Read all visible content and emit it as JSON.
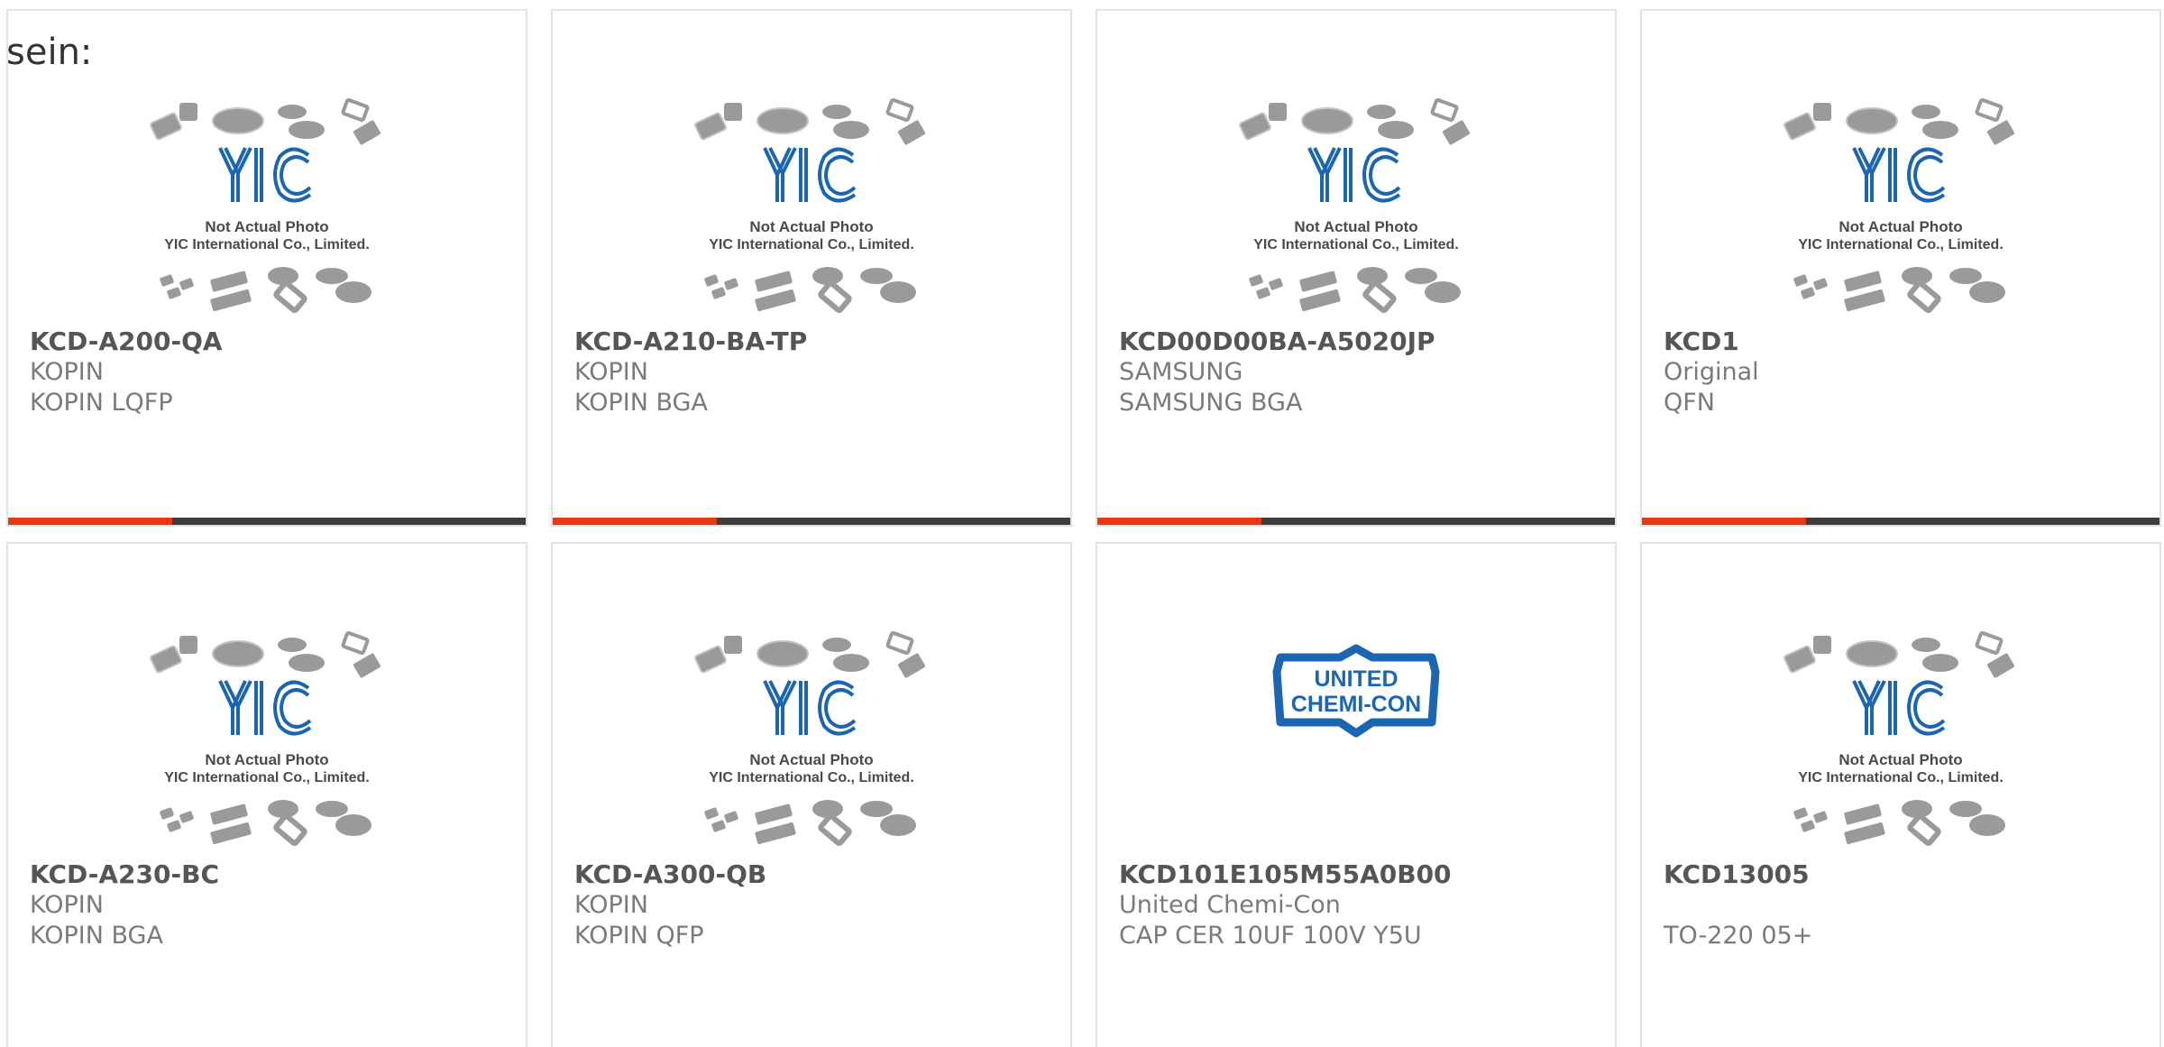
{
  "intro_text": "sein:",
  "image_caption": {
    "line1": "Not Actual Photo",
    "line2": "YIC International Co., Limited.",
    "logo_text": "YIC"
  },
  "brand_logo": {
    "line1": "UNITED",
    "line2": "CHEMI-CON"
  },
  "colors": {
    "accent": "#e8380d",
    "bar": "#3d3d3d",
    "logo_blue": "#1a66b3"
  },
  "products": [
    {
      "part": "KCD-A200-QA",
      "manufacturer": "KOPIN",
      "description": "KOPIN LQFP",
      "image": "yic-placeholder"
    },
    {
      "part": "KCD-A210-BA-TP",
      "manufacturer": "KOPIN",
      "description": "KOPIN BGA",
      "image": "yic-placeholder"
    },
    {
      "part": "KCD00D00BA-A5020JP",
      "manufacturer": "SAMSUNG",
      "description": "SAMSUNG BGA",
      "image": "yic-placeholder"
    },
    {
      "part": "KCD1",
      "manufacturer": "Original",
      "description": "QFN",
      "image": "yic-placeholder"
    },
    {
      "part": "KCD-A230-BC",
      "manufacturer": "KOPIN",
      "description": "KOPIN BGA",
      "image": "yic-placeholder"
    },
    {
      "part": "KCD-A300-QB",
      "manufacturer": "KOPIN",
      "description": "KOPIN QFP",
      "image": "yic-placeholder"
    },
    {
      "part": "KCD101E105M55A0B00",
      "manufacturer": "United Chemi-Con",
      "description": "CAP CER 10UF 100V Y5U",
      "image": "united-chemi-con-logo"
    },
    {
      "part": "KCD13005",
      "manufacturer": "",
      "description": "TO-220 05+",
      "image": "yic-placeholder"
    }
  ]
}
